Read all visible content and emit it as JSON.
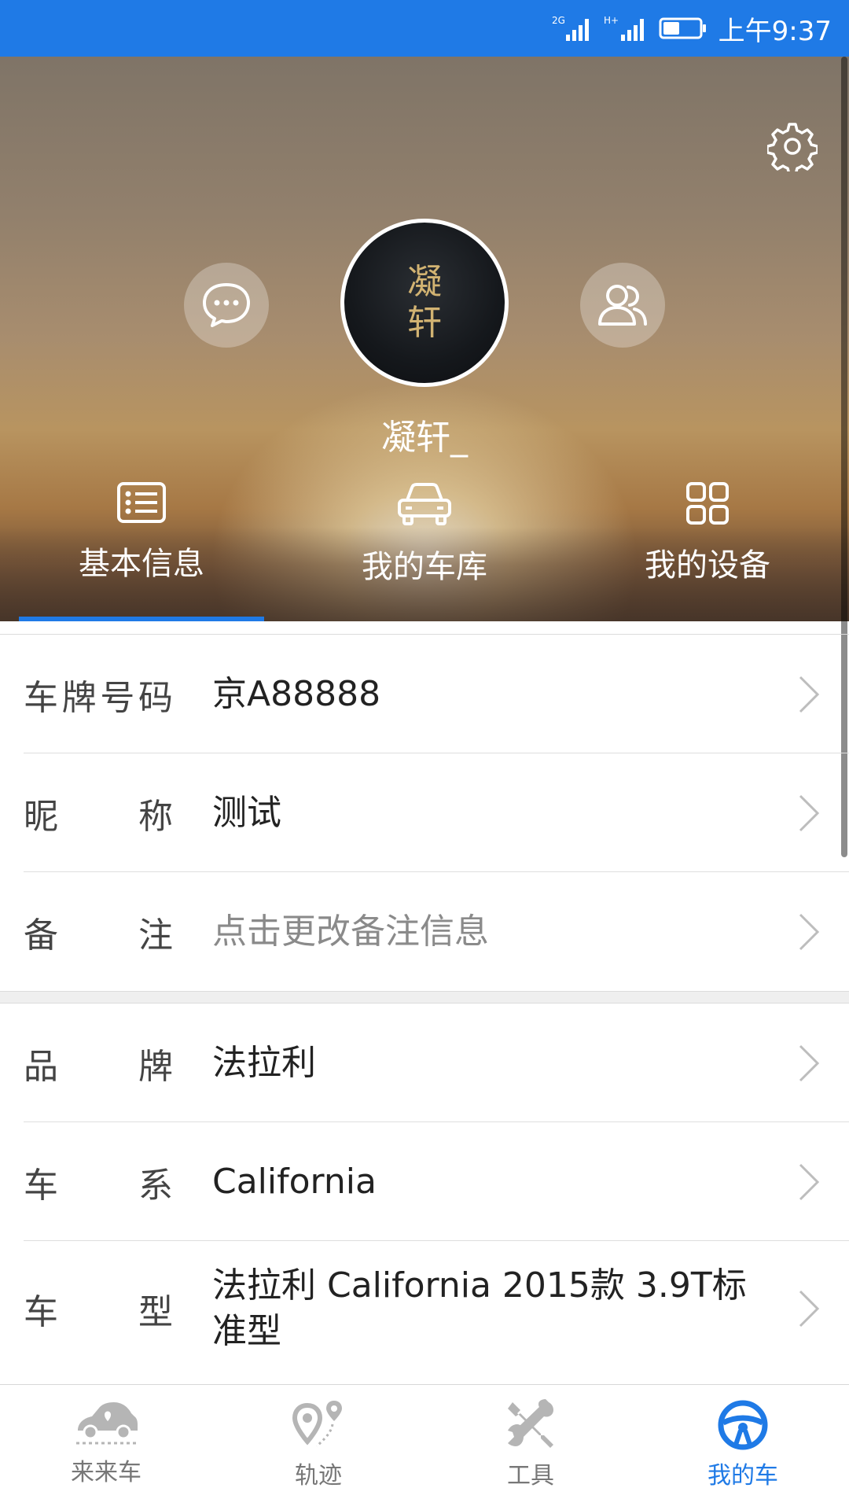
{
  "status_bar": {
    "network_1": "2G",
    "network_2": "H+",
    "time": "上午9:37",
    "color": "#1f7ae6"
  },
  "profile": {
    "avatar_text": [
      "凝",
      "轩"
    ],
    "username": "凝轩_",
    "icons": {
      "settings": "gear-icon",
      "message": "chat-bubble-icon",
      "friends": "users-icon"
    },
    "tabs": [
      {
        "label": "基本信息",
        "icon": "list-card-icon",
        "selected": true
      },
      {
        "label": "我的车库",
        "icon": "car-icon",
        "selected": false
      },
      {
        "label": "我的设备",
        "icon": "grid-icon",
        "selected": false
      }
    ]
  },
  "vehicle_info": {
    "group1": [
      {
        "label": "车牌号码",
        "value": "京A88888"
      },
      {
        "label": "昵称",
        "value": "测试"
      },
      {
        "label": "备注",
        "value": "点击更改备注信息",
        "is_placeholder": true
      }
    ],
    "group2": [
      {
        "label": "品牌",
        "value": "法拉利"
      },
      {
        "label": "车系",
        "value": "California"
      },
      {
        "label": "车型",
        "value": "法拉利 California 2015款 3.9T标准型"
      }
    ]
  },
  "bottom_nav": {
    "items": [
      {
        "label": "来来车",
        "icon": "car-map-icon",
        "active": false
      },
      {
        "label": "轨迹",
        "icon": "route-pin-icon",
        "active": false
      },
      {
        "label": "工具",
        "icon": "tools-icon",
        "active": false
      },
      {
        "label": "我的车",
        "icon": "steering-wheel-icon",
        "active": true
      }
    ],
    "active_color": "#1f7ae6",
    "inactive_color": "#777777"
  }
}
